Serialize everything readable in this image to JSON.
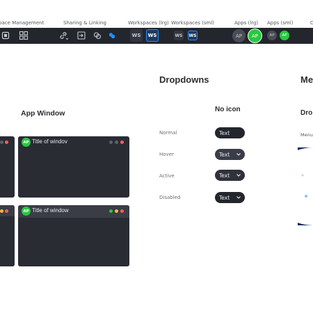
{
  "top_labels": {
    "space_mgmt": "pace Management",
    "sharing": "Sharing & Linking",
    "ws_lrg": "Workspaces (lrg)",
    "ws_sml": "Workspaces (sml)",
    "apps_lrg": "Apps (lrg)",
    "apps_sml": "Apps (sml)",
    "cut": "C"
  },
  "toolbar": {
    "ws_lrg": [
      "WS",
      "WS"
    ],
    "ws_sml": [
      "WS",
      "WS"
    ],
    "apps_lrg": [
      "AP",
      "AP"
    ],
    "apps_sml": [
      "AP",
      "AP"
    ],
    "accent": "#1f8fff",
    "green": "#27c93f"
  },
  "sections": {
    "app_window": "App Window",
    "dropdowns": "Dropdowns",
    "no_icon": "No icon",
    "menu_cut": "Me",
    "dro_cut": "Dro",
    "menu_label": "Menu"
  },
  "windows": [
    {
      "avatar": "AP",
      "title": "Title of windov",
      "active": false
    },
    {
      "avatar": "AP",
      "title": "Title of window",
      "active": true
    }
  ],
  "dropdowns": [
    {
      "state": "Normal",
      "value": "Text"
    },
    {
      "state": "Hover",
      "value": "Text"
    },
    {
      "state": "Active",
      "value": "Text"
    },
    {
      "state": "Disabled",
      "value": "Text"
    }
  ]
}
